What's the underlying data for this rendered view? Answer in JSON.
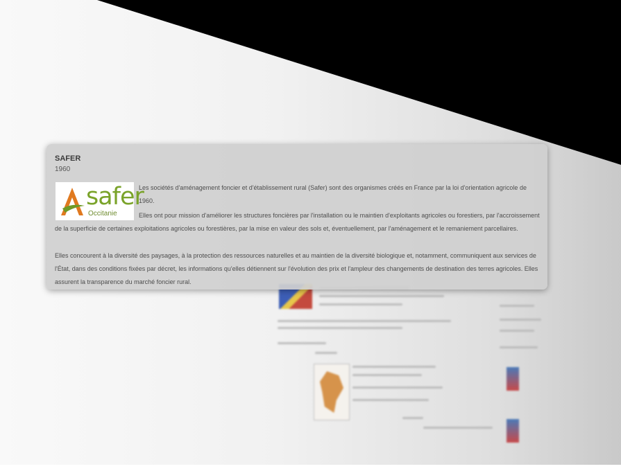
{
  "popup": {
    "title": "SAFER",
    "year": "1960",
    "logo": {
      "word": "safer",
      "subtitle": "Occitanie",
      "brand_color": "#7aa32a"
    },
    "paragraphs": [
      "Les sociétés d'aménagement foncier et d'établissement rural (Safer) sont des organismes créés en France par la loi d'orientation agricole de 1960.",
      "Elles ont pour mission d'améliorer les structures foncières par l'installation ou le maintien d'exploitants agricoles ou forestiers, par l'accroissement de la superficie de certaines exploitations agricoles ou forestières, par la mise en valeur des sols et, éventuellement, par l'aménagement et le remaniement parcellaires.",
      "Elles concourent à la diversité des paysages, à la protection des ressources naturelles et au maintien de la diversité biologique et, notamment, communiquent aux services de l'État, dans des conditions fixées par décret, les informations qu'elles détiennent sur l'évolution des prix et l'ampleur des changements de destination des terres agricoles. Elles assurent la transparence du marché foncier rural."
    ]
  },
  "colors": {
    "card_background": "#d0d0d0",
    "dark_region": "#000000"
  }
}
